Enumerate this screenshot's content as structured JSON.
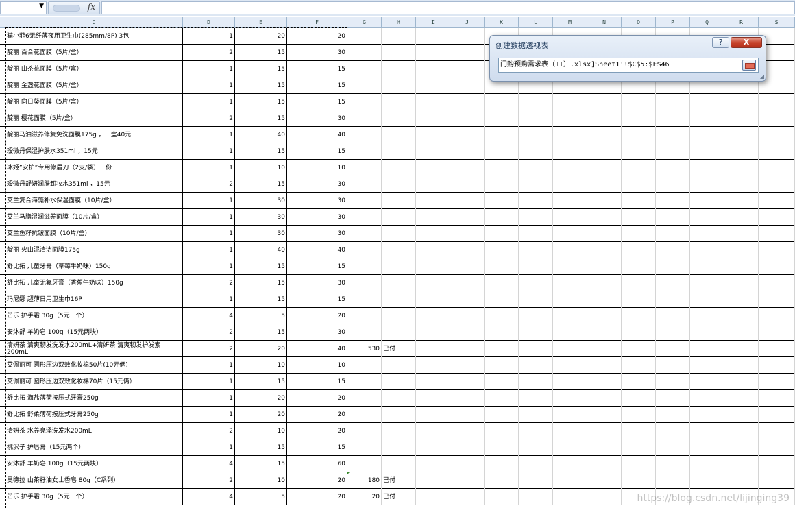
{
  "formula_bar": {
    "name_box_value": "",
    "fx_label": "fx",
    "formula_value": ""
  },
  "columns": [
    "C",
    "D",
    "E",
    "F",
    "G",
    "H",
    "I",
    "J",
    "K",
    "L",
    "M",
    "N",
    "O",
    "P",
    "Q",
    "R",
    "S"
  ],
  "rows": [
    {
      "c": "猫小菲6无纤薄夜用卫生巾(285mm/8P)  3包",
      "d": "1",
      "e": "20",
      "f": "20",
      "g": "",
      "h": ""
    },
    {
      "c": "靛丽 百合花面膜（5片/盒）",
      "d": "2",
      "e": "15",
      "f": "30",
      "g": "",
      "h": ""
    },
    {
      "c": "靛丽 山茶花面膜（5片/盒）",
      "d": "1",
      "e": "15",
      "f": "15",
      "g": "",
      "h": ""
    },
    {
      "c": "靛丽 金盏花面膜（5片/盒）",
      "d": "1",
      "e": "15",
      "f": "15",
      "g": "",
      "h": ""
    },
    {
      "c": "靛丽 向日葵面膜（5片/盒）",
      "d": "1",
      "e": "15",
      "f": "15",
      "g": "",
      "h": ""
    },
    {
      "c": "靛丽 樱花面膜（5片/盒）",
      "d": "2",
      "e": "15",
      "f": "30",
      "g": "",
      "h": ""
    },
    {
      "c": "靛丽马油滋养修复免洗面膜175g  ，一盒40元",
      "d": "1",
      "e": "40",
      "f": "40",
      "g": "",
      "h": ""
    },
    {
      "c": "瑷微丹保湿护肤水351ml  ，15元",
      "d": "1",
      "e": "15",
      "f": "15",
      "g": "",
      "h": ""
    },
    {
      "c": "冰姬”安护”专用修眉刀（2支/袋）一份",
      "d": "1",
      "e": "10",
      "f": "10",
      "g": "",
      "h": ""
    },
    {
      "c": "瑷微丹舒妍润肤卸妆水351ml  ，15元",
      "d": "2",
      "e": "15",
      "f": "30",
      "g": "",
      "h": ""
    },
    {
      "c": "艾兰复合海藻补水保湿面膜（10片/盒）",
      "d": "1",
      "e": "30",
      "f": "30",
      "g": "",
      "h": ""
    },
    {
      "c": "艾兰马脂湿润滋养面膜（10片/盒）",
      "d": "1",
      "e": "30",
      "f": "30",
      "g": "",
      "h": ""
    },
    {
      "c": "艾兰鱼籽抗皱面膜（10片/盒）",
      "d": "1",
      "e": "30",
      "f": "30",
      "g": "",
      "h": ""
    },
    {
      "c": "靛丽 火山泥清洁面膜175g",
      "d": "1",
      "e": "40",
      "f": "40",
      "g": "",
      "h": ""
    },
    {
      "c": "舒比拓 儿童牙膏（草莓牛奶味）150g",
      "d": "1",
      "e": "15",
      "f": "15",
      "g": "",
      "h": ""
    },
    {
      "c": "舒比拓 儿童无氟牙膏（香蕉牛奶味）150g",
      "d": "2",
      "e": "15",
      "f": "30",
      "g": "",
      "h": ""
    },
    {
      "c": "玛尼娜 超薄日用卫生巾16P",
      "d": "1",
      "e": "15",
      "f": "15",
      "g": "",
      "h": ""
    },
    {
      "c": "芒乐 护手霜 30g（5元一个）",
      "d": "4",
      "e": "5",
      "f": "20",
      "g": "",
      "h": ""
    },
    {
      "c": "安沐舒 羊奶皂 100g（15元两块）",
      "d": "2",
      "e": "15",
      "f": "30",
      "g": "",
      "h": ""
    },
    {
      "c": "清妍茶 清爽韧发洗发水200mL+清妍茶 清爽韧发护发素200mL",
      "d": "2",
      "e": "20",
      "f": "40",
      "g": "530",
      "h": "已付"
    },
    {
      "c": "艾佩丽可 圆形压边双效化妆棉50片(10元俩)",
      "d": "1",
      "e": "10",
      "f": "10",
      "g": "",
      "h": ""
    },
    {
      "c": "艾佩丽可 圆形压边双效化妆棉70片（15元俩）",
      "d": "1",
      "e": "15",
      "f": "15",
      "g": "",
      "h": ""
    },
    {
      "c": "舒比拓 海盐薄荷按压式牙膏250g",
      "d": "1",
      "e": "20",
      "f": "20",
      "g": "",
      "h": ""
    },
    {
      "c": "舒比拓 舒柔薄荷按压式牙膏250g",
      "d": "1",
      "e": "20",
      "f": "20",
      "g": "",
      "h": ""
    },
    {
      "c": "清妍茶 水养亮泽洗发水200mL",
      "d": "2",
      "e": "10",
      "f": "20",
      "g": "",
      "h": ""
    },
    {
      "c": "桃沢子 护唇膏（15元两个）",
      "d": "1",
      "e": "15",
      "f": "15",
      "g": "",
      "h": ""
    },
    {
      "c": "安沐舒 羊奶皂 100g（15元两块）",
      "d": "4",
      "e": "15",
      "f": "60",
      "g": "",
      "h": ""
    },
    {
      "c": "吴德拉 山茶籽油女士香皂 80g（C系列）",
      "d": "2",
      "e": "10",
      "f": "20",
      "g": "180",
      "h": "已付"
    },
    {
      "c": "芒乐 护手霜 30g（5元一个）",
      "d": "4",
      "e": "5",
      "f": "20",
      "g": "20",
      "h": "已付"
    }
  ],
  "dialog": {
    "title": "创建数据透视表",
    "help_label": "?",
    "close_label": "X",
    "range_value": "门购预购需求表（IT）.xlsx]Sheet1'!$C$5:$F$46"
  },
  "watermark": "https://blog.csdn.net/lijinging39"
}
